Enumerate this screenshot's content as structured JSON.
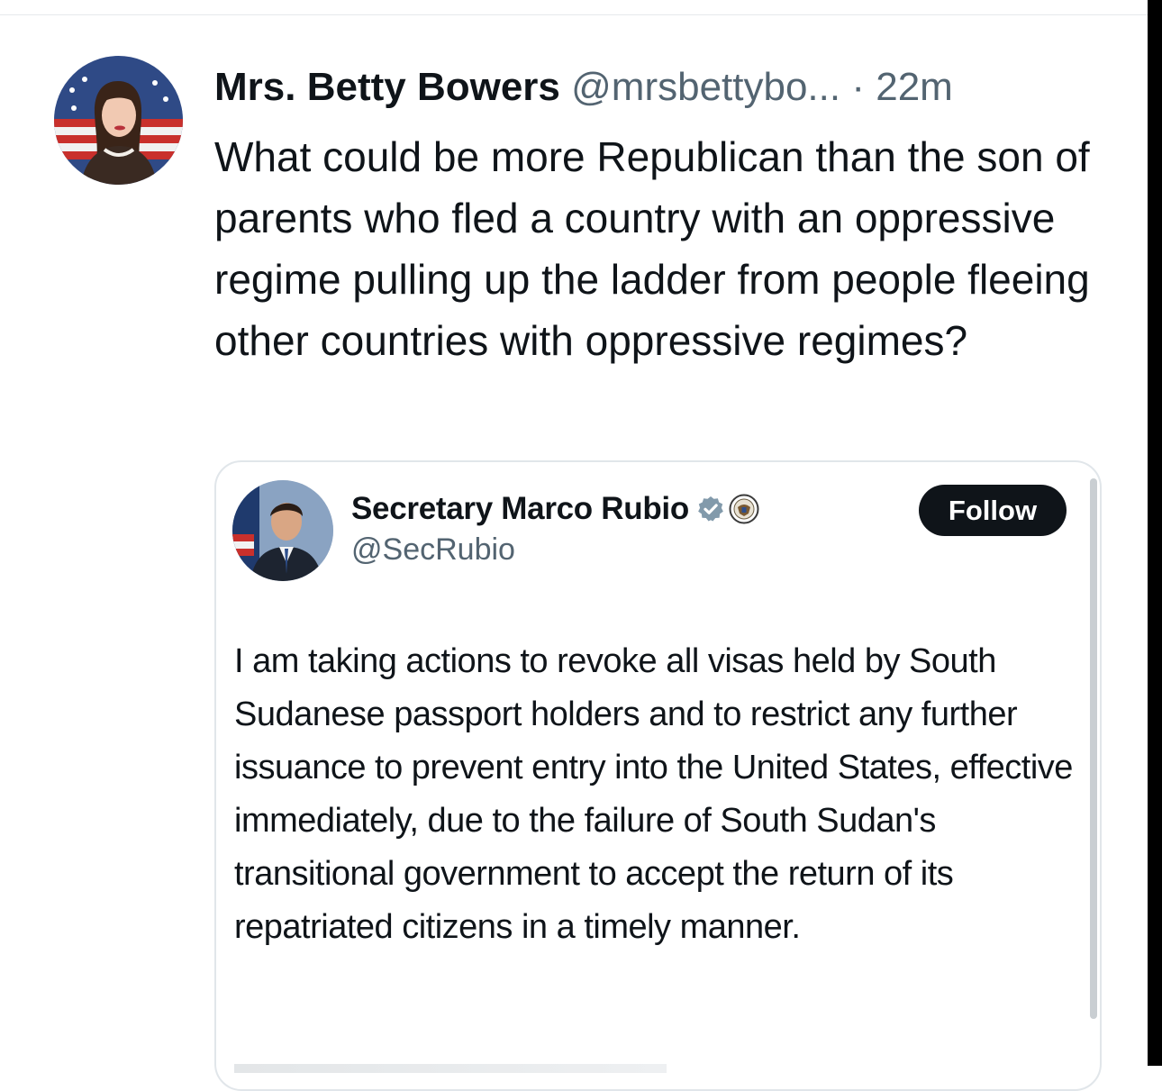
{
  "tweet": {
    "author_name": "Mrs. Betty Bowers",
    "author_handle": "@mrsbettybo...",
    "separator": "·",
    "timestamp": "22m",
    "text": "What could be more Republican than the son of parents who fled a country with an oppressive regime pulling up the ladder from people fleeing other countries with oppressive regimes?",
    "avatar_icon": "portrait-woman-flag-avatar"
  },
  "quoted_tweet": {
    "author_name": "Secretary Marco Rubio",
    "author_handle": "@SecRubio",
    "verified_icon": "gray-verified-badge-icon",
    "affiliation_icon": "state-department-seal-icon",
    "follow_label": "Follow",
    "text": "I am taking actions to revoke all visas held by South Sudanese passport holders and to restrict any further issuance to prevent entry into the United States, effective immediately, due to the failure of South Sudan's transitional government to accept the return of its repatriated citizens in a timely manner.",
    "avatar_icon": "portrait-man-flag-avatar"
  },
  "colors": {
    "text_primary": "#0f1419",
    "text_secondary": "#536471",
    "border": "#e1e6ea",
    "verified_gray": "#829aab",
    "follow_button_bg": "#0f1419"
  }
}
